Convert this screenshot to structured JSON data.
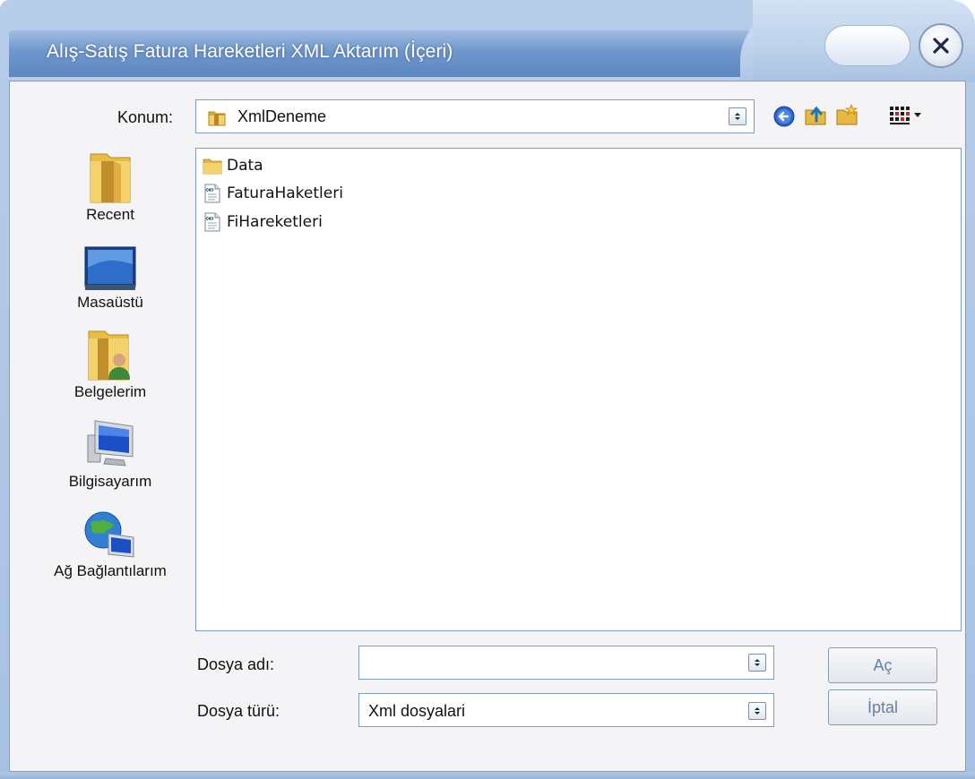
{
  "window": {
    "title": "Alış-Satış Fatura Hareketleri XML Aktarım (İçeri)"
  },
  "location": {
    "label": "Konum:",
    "value": "XmlDeneme"
  },
  "toolbar": {
    "icons": [
      "back-icon",
      "up-folder-icon",
      "new-folder-icon",
      "view-menu-icon"
    ]
  },
  "places": [
    {
      "label": "Recent",
      "icon": "recent-folder-icon"
    },
    {
      "label": "Masaüstü",
      "icon": "desktop-icon"
    },
    {
      "label": "Belgelerim",
      "icon": "documents-icon"
    },
    {
      "label": "Bilgisayarım",
      "icon": "computer-icon"
    },
    {
      "label": "Ağ Bağlantılarım",
      "icon": "network-icon"
    }
  ],
  "files": [
    {
      "name": "Data",
      "type": "folder"
    },
    {
      "name": "FaturaHaketleri",
      "type": "xml-file"
    },
    {
      "name": "FiHareketleri",
      "type": "xml-file"
    }
  ],
  "filename": {
    "label": "Dosya adı:",
    "value": ""
  },
  "filetype": {
    "label": "Dosya türü:",
    "value": "Xml dosyalari"
  },
  "buttons": {
    "open": "Aç",
    "cancel": "İptal"
  }
}
